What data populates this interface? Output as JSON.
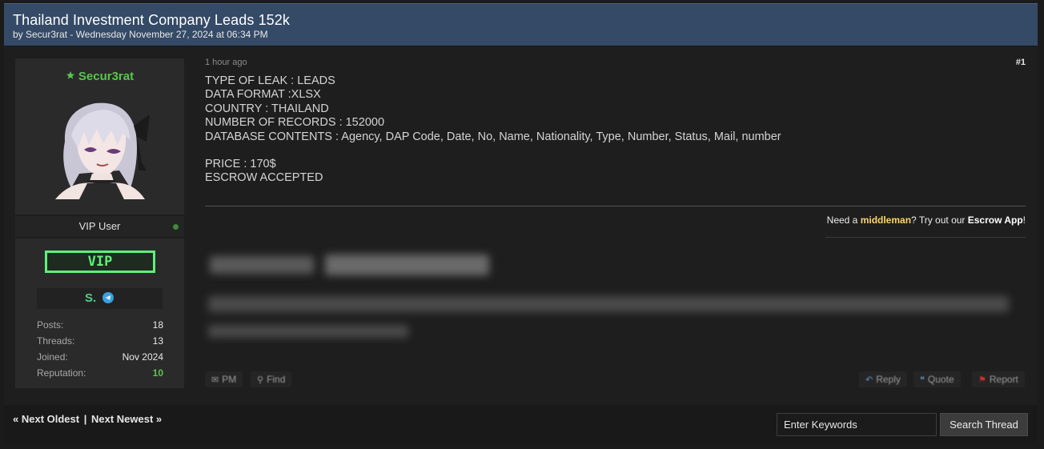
{
  "thread": {
    "title": "Thailand Investment Company Leads 152k",
    "subtitle": "by Secur3rat - Wednesday November 27, 2024 at 06:34 PM"
  },
  "author": {
    "username": "Secur3rat",
    "user_title": "VIP User",
    "badge": "VIP",
    "contact_icons": [
      "session-icon",
      "telegram-icon"
    ],
    "stats": [
      {
        "label": "Posts:",
        "value": "18"
      },
      {
        "label": "Threads:",
        "value": "13"
      },
      {
        "label": "Joined:",
        "value": "Nov 2024"
      },
      {
        "label": "Reputation:",
        "value": "10"
      }
    ],
    "online_color": "#3d8b3a",
    "name_color": "#56c84a"
  },
  "post": {
    "time": "1 hour ago",
    "number": "#1",
    "lines": [
      "TYPE OF LEAK : LEADS",
      "DATA FORMAT :XLSX",
      "COUNTRY : THAILAND",
      "NUMBER OF RECORDS : 152000",
      "DATABASE CONTENTS : Agency, DAP Code, Date, No, Name, Nationality, Type, Number, Status, Mail, number",
      "",
      "PRICE : 170$",
      "ESCROW ACCEPTED"
    ],
    "signature": {
      "prefix": "Need a ",
      "middleman": "middleman",
      "mid": "? Try out our ",
      "escrow": "Escrow App",
      "suffix": "!"
    },
    "buttons": {
      "pm": "PM",
      "find": "Find",
      "reply": "Reply",
      "quote": "Quote",
      "report": "Report"
    }
  },
  "navigation": {
    "prev": "« Next Oldest",
    "separator": "|",
    "next": "Next Newest »"
  },
  "search": {
    "placeholder": "Enter Keywords",
    "button": "Search Thread"
  },
  "colors": {
    "header_bg": "#344a66",
    "vip_green": "#5ff07a",
    "reputation_green": "#58c84a",
    "middleman_yellow": "#ffd566"
  }
}
